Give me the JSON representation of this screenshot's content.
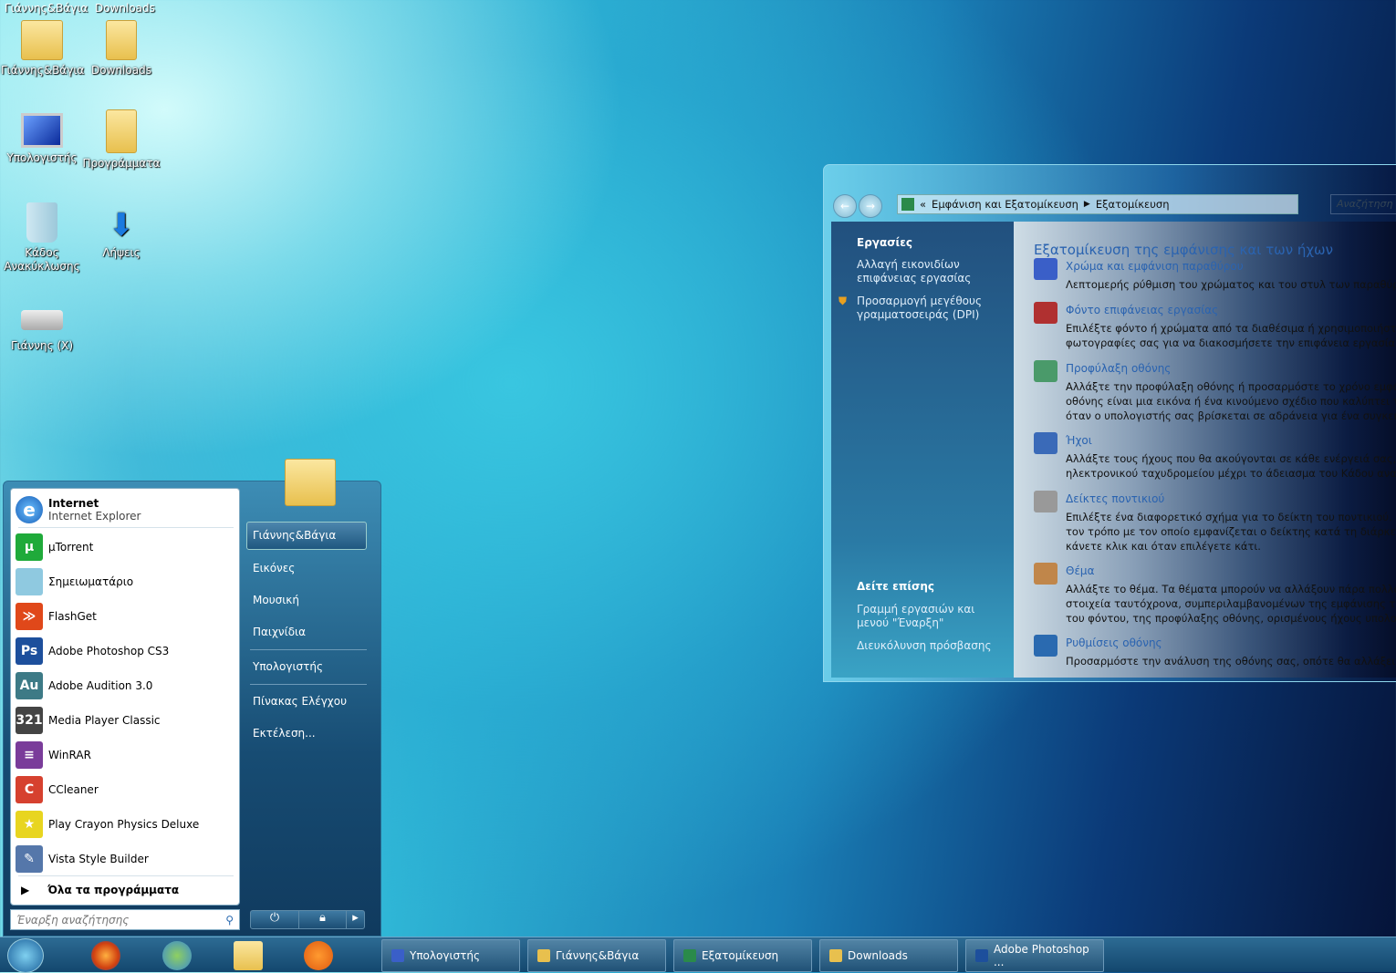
{
  "desktop": {
    "partial_labels": [
      "Γιάννης&Βάγια",
      "Downloads"
    ],
    "icons": [
      {
        "label": "Γιάννης&Βάγια",
        "icon": "user-folder-icon"
      },
      {
        "label": "Downloads",
        "icon": "downloads-folder-icon"
      },
      {
        "label": "Υπολογιστής",
        "icon": "computer-icon"
      },
      {
        "label": "Προγράμματα",
        "icon": "folder-icon"
      },
      {
        "label": "Κάδος Ανακύκλωσης",
        "icon": "recycle-bin-icon"
      },
      {
        "label": "Λήψεις",
        "icon": "download-shortcut-icon"
      },
      {
        "label": "Γιάννης (X)",
        "icon": "drive-shortcut-icon"
      }
    ]
  },
  "start_menu": {
    "pinned": {
      "title": "Internet",
      "subtitle": "Internet Explorer"
    },
    "programs": [
      {
        "label": "µTorrent",
        "color": "#1faa3a",
        "glyph": "µ"
      },
      {
        "label": "Σημειωματάριο",
        "color": "#8fc9e0",
        "glyph": ""
      },
      {
        "label": "FlashGet",
        "color": "#e0481a",
        "glyph": "≫"
      },
      {
        "label": "Adobe Photoshop CS3",
        "color": "#1d4f9c",
        "glyph": "Ps"
      },
      {
        "label": "Adobe Audition 3.0",
        "color": "#3d7a86",
        "glyph": "Au"
      },
      {
        "label": "Media Player Classic",
        "color": "#444",
        "glyph": "321"
      },
      {
        "label": "WinRAR",
        "color": "#7a3c9a",
        "glyph": "≡"
      },
      {
        "label": "CCleaner",
        "color": "#d6412f",
        "glyph": "C"
      },
      {
        "label": "Play Crayon Physics Deluxe",
        "color": "#e8d520",
        "glyph": "★"
      },
      {
        "label": "Vista Style Builder",
        "color": "#5577aa",
        "glyph": "✎"
      }
    ],
    "all_programs": "Όλα τα προγράμματα",
    "search_placeholder": "Έναρξη αναζήτησης",
    "right_items": [
      "Γιάννης&Βάγια",
      "Εικόνες",
      "Μουσική",
      "Παιχνίδια",
      "Υπολογιστής",
      "Πίνακας Ελέγχου",
      "Εκτέλεση..."
    ]
  },
  "window": {
    "breadcrumb": [
      "Εμφάνιση και Εξατομίκευση",
      "Εξατομίκευση"
    ],
    "search_placeholder": "Αναζήτηση",
    "tasks_heading": "Εργασίες",
    "tasks": [
      "Αλλαγή εικονιδίων επιφάνειας εργασίας",
      "Προσαρμογή μεγέθους γραμματοσειράς (DPI)"
    ],
    "see_also_heading": "Δείτε επίσης",
    "see_also": [
      "Γραμμή εργασιών και μενού \"Έναρξη\"",
      "Διευκόλυνση πρόσβασης"
    ],
    "heading": "Εξατομίκευση της εμφάνισης και των ήχων",
    "items": [
      {
        "title": "Χρώμα και εμφάνιση παραθύρου",
        "desc": [
          "Λεπτομερής ρύθμιση του χρώματος και του στυλ των παραθύρων"
        ],
        "color": "#3a5fc8"
      },
      {
        "title": "Φόντο επιφάνειας εργασίας",
        "desc": [
          "Επιλέξτε φόντο ή χρώματα από τα διαθέσιμα ή χρησιμοποιήστε κάποιες",
          "φωτογραφίες σας για να διακοσμήσετε την επιφάνεια εργασίας σας"
        ],
        "color": "#b03030"
      },
      {
        "title": "Προφύλαξη οθόνης",
        "desc": [
          "Αλλάξτε την προφύλαξη οθόνης ή προσαρμόστε το χρόνο εμφάνισης",
          "οθόνης είναι μια εικόνα ή ένα κινούμενο σχέδιο που καλύπτει την οθόνη",
          "όταν ο υπολογιστής σας βρίσκεται σε αδράνεια για ένα συγκεκριμένο"
        ],
        "color": "#4a9a6a"
      },
      {
        "title": "Ήχοι",
        "desc": [
          "Αλλάξτε τους ήχους που θα ακούγονται σε κάθε ενέργειά σας, από",
          "ηλεκτρονικού ταχυδρομείου μέχρι το άδειασμα του Κάδου ανακύκλωσης"
        ],
        "color": "#3a6ab8"
      },
      {
        "title": "Δείκτες ποντικιού",
        "desc": [
          "Επιλέξτε ένα διαφορετικό σχήμα για το δείκτη του ποντικιού. Μπορείτε",
          "τον τρόπο με τον οποίο εμφανίζεται ο δείκτης κατά τη διάρκεια ενεργειών",
          "κάνετε κλικ και όταν επιλέγετε κάτι."
        ],
        "color": "#999"
      },
      {
        "title": "Θέμα",
        "desc": [
          "Αλλάξτε το θέμα. Τα θέματα μπορούν να αλλάξουν πάρα πολλά οπτικά",
          "στοιχεία ταυτόχρονα, συμπεριλαμβανομένων της εμφάνισης των μενού,",
          "του φόντου, της προφύλαξης οθόνης, ορισμένους ήχους υπολογιστή"
        ],
        "color": "#c0864a"
      },
      {
        "title": "Ρυθμίσεις οθόνης",
        "desc": [
          "Προσαρμόστε την ανάλυση της οθόνης σας, οπότε θα αλλάξει η προβολή"
        ],
        "color": "#2a6ab0"
      }
    ]
  },
  "taskbar": {
    "buttons": [
      {
        "label": "Υπολογιστής",
        "color": "#3a5fc8"
      },
      {
        "label": "Γιάννης&Βάγια",
        "color": "#e8c04e"
      },
      {
        "label": "Εξατομίκευση",
        "color": "#2a8a4a"
      },
      {
        "label": "Downloads",
        "color": "#e8c04e"
      },
      {
        "label": "Adobe Photoshop ...",
        "color": "#1d4f9c"
      }
    ],
    "quick_launch": [
      "firefox-icon",
      "messenger-icon",
      "explorer-icon",
      "media-player-icon"
    ]
  }
}
